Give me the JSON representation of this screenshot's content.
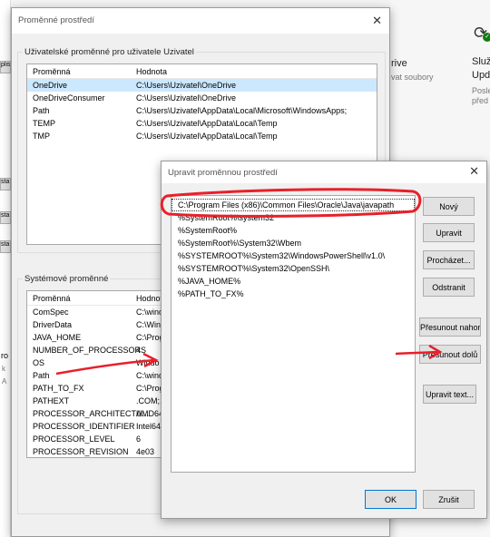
{
  "background": {
    "right_panel": [
      {
        "title": "Služ",
        "sub": "Posle"
      },
      {
        "title": "Upd",
        "sub": "před"
      }
    ],
    "drive_text": "rive",
    "drive_sub": "vat soubory",
    "strip_buttons": [
      "plis",
      "sta",
      "sta",
      "sta"
    ],
    "left_fragments": [
      "ro",
      "k",
      "A"
    ]
  },
  "env_dialog": {
    "title": "Proměnné prostředí",
    "user_group_label": "Uživatelské proměnné pro uživatele Uzivatel",
    "columns": [
      "Proměnná",
      "Hodnota"
    ],
    "user_vars": [
      {
        "name": "OneDrive",
        "value": "C:\\Users\\Uzivatel\\OneDrive"
      },
      {
        "name": "OneDriveConsumer",
        "value": "C:\\Users\\Uzivatel\\OneDrive"
      },
      {
        "name": "Path",
        "value": "C:\\Users\\Uzivatel\\AppData\\Local\\Microsoft\\WindowsApps;"
      },
      {
        "name": "TEMP",
        "value": "C:\\Users\\Uzivatel\\AppData\\Local\\Temp"
      },
      {
        "name": "TMP",
        "value": "C:\\Users\\Uzivatel\\AppData\\Local\\Temp"
      }
    ],
    "system_group_label": "Systémové proměnné",
    "system_columns": [
      "Proměnná",
      "Hodnot"
    ],
    "system_vars": [
      {
        "name": "ComSpec",
        "value": "C:\\wind"
      },
      {
        "name": "DriverData",
        "value": "C:\\Wind"
      },
      {
        "name": "JAVA_HOME",
        "value": "C:\\Prog"
      },
      {
        "name": "NUMBER_OF_PROCESSORS",
        "value": "4"
      },
      {
        "name": "OS",
        "value": "Windo"
      },
      {
        "name": "Path",
        "value": "C:\\wind"
      },
      {
        "name": "PATH_TO_FX",
        "value": "C:\\Prog"
      },
      {
        "name": "PATHEXT",
        "value": ".COM;.E"
      },
      {
        "name": "PROCESSOR_ARCHITECTU...",
        "value": "AMD64"
      },
      {
        "name": "PROCESSOR_IDENTIFIER",
        "value": "Intel64"
      },
      {
        "name": "PROCESSOR_LEVEL",
        "value": "6"
      },
      {
        "name": "PROCESSOR_REVISION",
        "value": "4e03"
      }
    ]
  },
  "edit_dialog": {
    "title": "Upravit proměnnou prostředí",
    "path_entries": [
      "C:\\Program Files (x86)\\Common Files\\Oracle\\Java\\javapath",
      "%SystemRoot%\\system32",
      "%SystemRoot%",
      "%SystemRoot%\\System32\\Wbem",
      "%SYSTEMROOT%\\System32\\WindowsPowerShell\\v1.0\\",
      "%SYSTEMROOT%\\System32\\OpenSSH\\",
      "%JAVA_HOME%",
      "%PATH_TO_FX%"
    ],
    "buttons": {
      "new": "Nový",
      "edit": "Upravit",
      "browse": "Procházet...",
      "delete": "Odstranit",
      "move_up": "Přesunout nahoru",
      "move_down": "Přesunout dolů",
      "edit_text": "Upravit text...",
      "ok": "OK",
      "cancel": "Zrušit"
    }
  },
  "colors": {
    "annotation_red": "#e8202a",
    "selection": "#cce8ff",
    "accent": "#0078d7"
  }
}
